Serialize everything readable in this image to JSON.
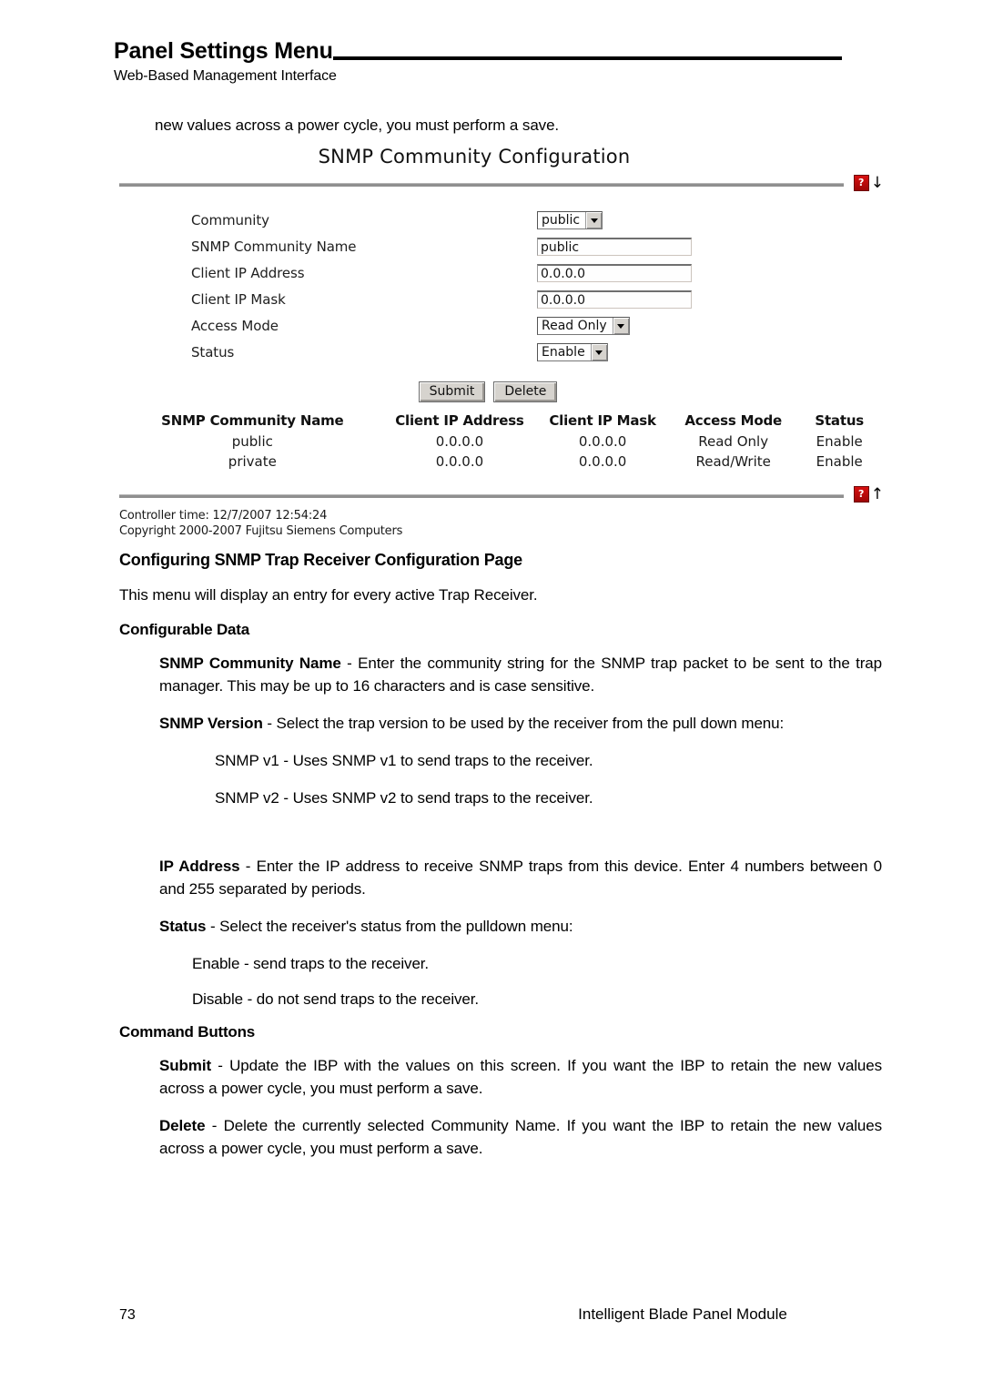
{
  "header": {
    "title": "Panel Settings Menu",
    "subtitle": "Web-Based Management Interface"
  },
  "intro_line": "new values across a power cycle, you must perform a save.",
  "webui": {
    "title": "SNMP Community Configuration",
    "help_icon_label": "?",
    "arrow_down": "↓",
    "arrow_up": "↑",
    "fields": [
      {
        "label": "Community",
        "control": "select",
        "value": "public"
      },
      {
        "label": "SNMP Community Name",
        "control": "input",
        "value": "public"
      },
      {
        "label": "Client IP Address",
        "control": "input",
        "value": "0.0.0.0"
      },
      {
        "label": "Client IP Mask",
        "control": "input",
        "value": "0.0.0.0"
      },
      {
        "label": "Access Mode",
        "control": "select",
        "value": "Read Only"
      },
      {
        "label": "Status",
        "control": "select",
        "value": "Enable"
      }
    ],
    "buttons": {
      "submit": "Submit",
      "delete": "Delete"
    },
    "table": {
      "headers": [
        "SNMP Community Name",
        "Client IP Address",
        "Client IP Mask",
        "Access Mode",
        "Status"
      ],
      "rows": [
        [
          "public",
          "0.0.0.0",
          "0.0.0.0",
          "Read Only",
          "Enable"
        ],
        [
          "private",
          "0.0.0.0",
          "0.0.0.0",
          "Read/Write",
          "Enable"
        ]
      ]
    },
    "footer_time": "Controller time: 12/7/2007 12:54:24",
    "footer_copyright": "Copyright 2000-2007 Fujitsu Siemens Computers"
  },
  "body": {
    "section_heading": "Configuring SNMP Trap Receiver Configuration Page",
    "section_intro": "This menu will display an entry for every active Trap Receiver.",
    "configurable_data_heading": "Configurable Data",
    "community_name_lead": "SNMP Community Name",
    "community_name_text": " - Enter the community string for the SNMP trap packet to be sent to the trap manager. This may be up to 16 characters and is case sensitive.",
    "snmp_version_lead": "SNMP Version",
    "snmp_version_text": " - Select the trap version to be used by the receiver from the pull down menu:",
    "snmp_v1_text": "SNMP v1 - Uses SNMP v1 to send traps to the receiver.",
    "snmp_v2_text": "SNMP v2 - Uses SNMP v2 to send traps to the receiver.",
    "ip_address_lead": "IP Address",
    "ip_address_text": " - Enter the IP address to receive SNMP traps from this device. Enter 4 numbers between 0 and 255 separated by periods.",
    "status_lead": "Status",
    "status_text": " - Select the receiver's status from the pulldown menu:",
    "status_enable_text": "Enable - send traps to the receiver.",
    "status_disable_text": "Disable - do not send traps to the receiver.",
    "command_buttons_heading": "Command Buttons",
    "submit_lead": "Submit",
    "submit_text": " - Update the IBP with the values on this screen. If you want the IBP to retain the new values across a power cycle, you must perform a save.",
    "delete_lead": "Delete",
    "delete_text": " - Delete the currently selected Community Name. If you want the IBP to retain the new values across a power cycle, you must perform a save."
  },
  "page_footer": {
    "page_number": "73",
    "product": "Intelligent Blade Panel Module"
  }
}
